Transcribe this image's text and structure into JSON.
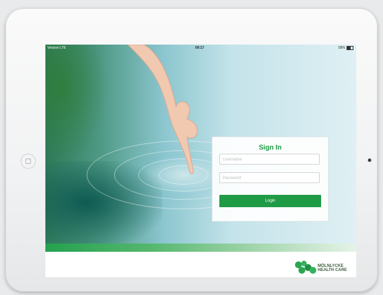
{
  "status_bar": {
    "carrier": "Verizon LTE",
    "time": "09:17",
    "battery": "58%"
  },
  "login": {
    "title": "Sign In",
    "username_placeholder": "Username",
    "password_placeholder": "Password",
    "login_label": "Login"
  },
  "brand": {
    "line1": "MÖLNLYCKE",
    "line2": "HEALTH CARE"
  },
  "colors": {
    "accent_green": "#1f9b46",
    "tablet_frame": "#f3f4f5"
  },
  "icons": [
    "home-button-icon",
    "camera-icon",
    "battery-icon",
    "molnlycke-logo-icon"
  ]
}
